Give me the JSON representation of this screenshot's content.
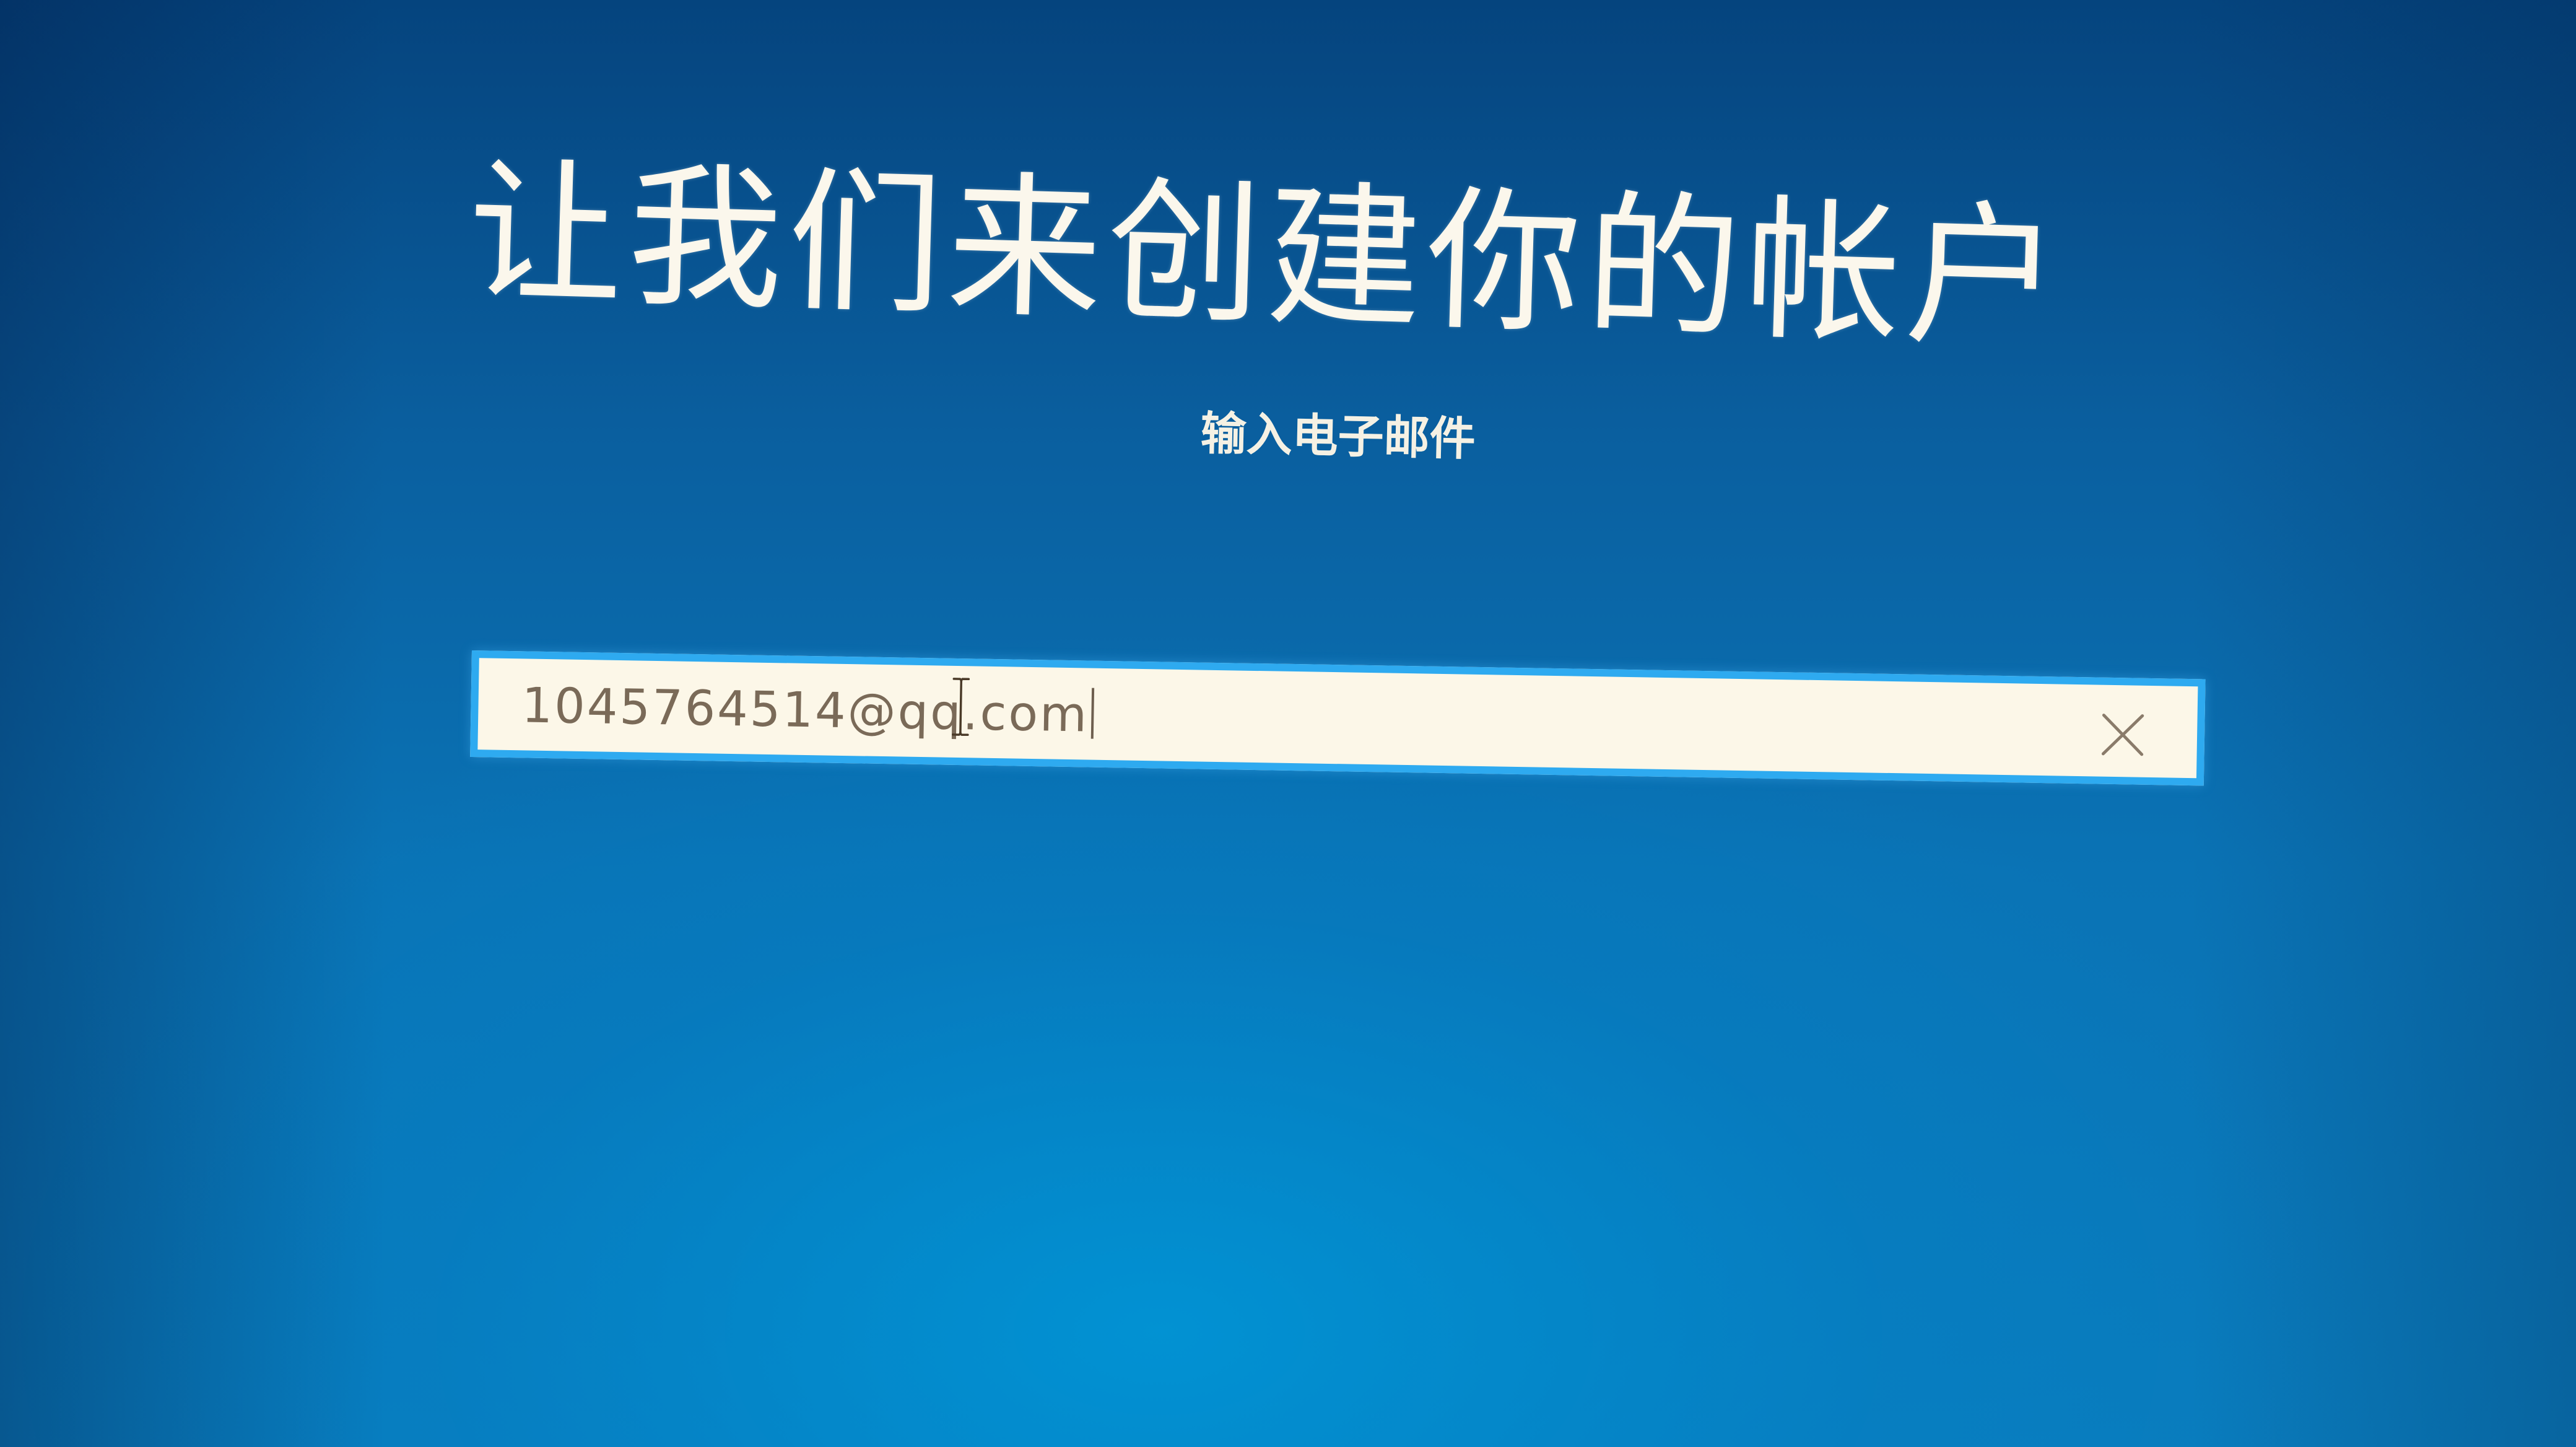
{
  "signup": {
    "title": "让我们来创建你的帐户",
    "subtitle": "输入电子邮件",
    "email_field": {
      "value": "1045764514@qq.com",
      "clear_icon": "close-icon"
    }
  },
  "colors": {
    "background": "#0a6fb0",
    "field_border": "#2eaaf0",
    "title_text": "#fbf7ec"
  }
}
